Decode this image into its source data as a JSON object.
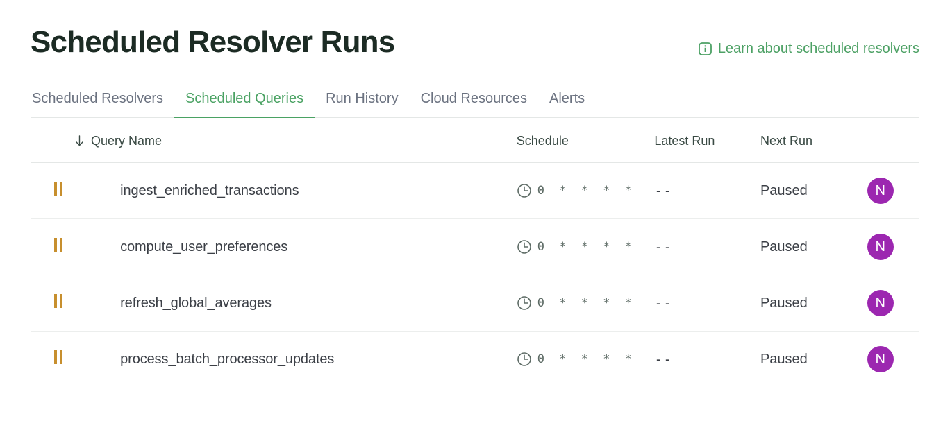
{
  "header": {
    "title": "Scheduled Resolver Runs",
    "learn_link": {
      "label": "Learn about scheduled resolvers",
      "icon": "info-icon",
      "color": "#4da165"
    }
  },
  "tabs": [
    {
      "label": "Scheduled Resolvers",
      "active": false
    },
    {
      "label": "Scheduled Queries",
      "active": true
    },
    {
      "label": "Run History",
      "active": false
    },
    {
      "label": "Cloud Resources",
      "active": false
    },
    {
      "label": "Alerts",
      "active": false
    }
  ],
  "table": {
    "sort_icon": "arrow-down-icon",
    "columns": {
      "action": "",
      "name": "Query Name",
      "schedule": "Schedule",
      "latest_run": "Latest Run",
      "next_run": "Next Run",
      "owner": ""
    },
    "rows": [
      {
        "action_icon": "pause-icon",
        "name": "ingest_enriched_transactions",
        "schedule_icon": "clock-icon",
        "schedule": "0 * * * *",
        "latest_run": "--",
        "next_run": "Paused",
        "owner_initial": "N"
      },
      {
        "action_icon": "pause-icon",
        "name": "compute_user_preferences",
        "schedule_icon": "clock-icon",
        "schedule": "0 * * * *",
        "latest_run": "--",
        "next_run": "Paused",
        "owner_initial": "N"
      },
      {
        "action_icon": "pause-icon",
        "name": "refresh_global_averages",
        "schedule_icon": "clock-icon",
        "schedule": "0 * * * *",
        "latest_run": "--",
        "next_run": "Paused",
        "owner_initial": "N"
      },
      {
        "action_icon": "pause-icon",
        "name": "process_batch_processor_updates",
        "schedule_icon": "clock-icon",
        "schedule": "0 * * * *",
        "latest_run": "--",
        "next_run": "Paused",
        "owner_initial": "N"
      }
    ]
  },
  "colors": {
    "title": "#1c2b24",
    "accent_green": "#4aa263",
    "pause_amber": "#c78f2e",
    "avatar_purple": "#9c27b0",
    "muted_text": "#6b7280",
    "divider": "#e4e7e6"
  }
}
